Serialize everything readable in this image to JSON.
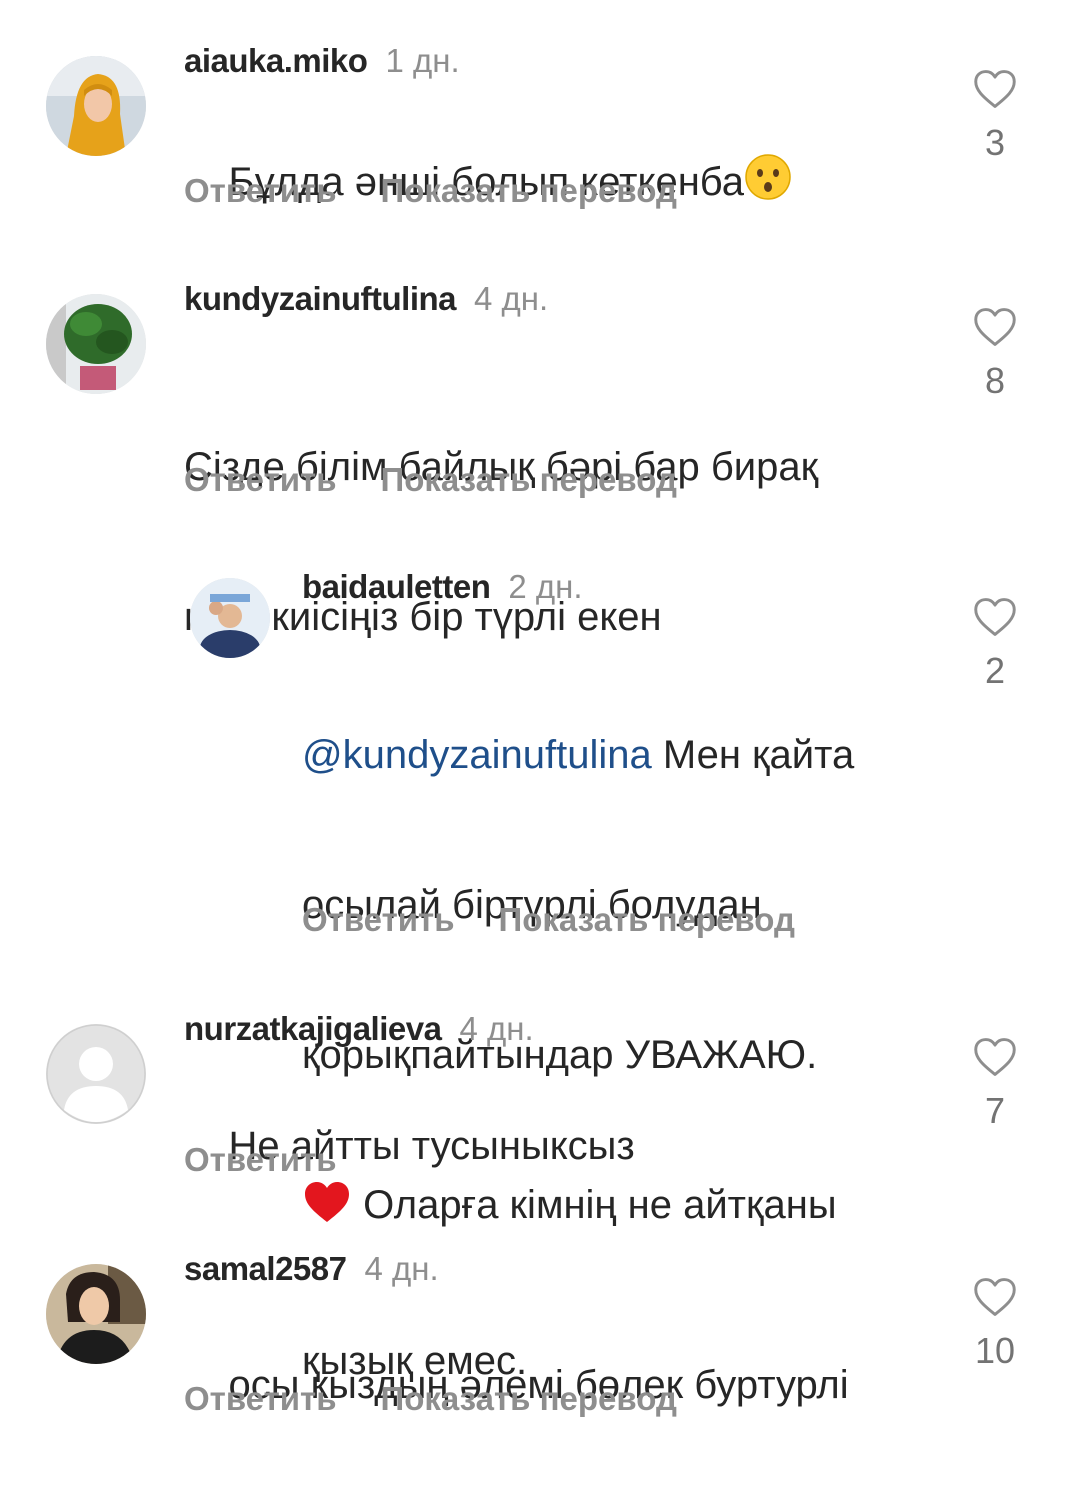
{
  "comments": [
    {
      "username": "aiauka.miko",
      "time": "1 дн.",
      "text": "Бұлда әнші болып кеткенба",
      "emoji": "hushed-face",
      "reply_label": "Ответить",
      "translate_label": "Показать перевод",
      "likes": "3"
    },
    {
      "username": "kundyzainuftulina",
      "time": "4 дн.",
      "text_line1": "Сізде білім байлық бәрі бар бирақ",
      "text_line2": "киім киісіңіз бір түрлі екен",
      "reply_label": "Ответить",
      "translate_label": "Показать перевод",
      "likes": "8"
    },
    {
      "username": "baidauletten",
      "time": "2 дн.",
      "mention": "@kundyzainuftulina",
      "text_after_mention": " Мен қайта",
      "text_line2": "осылай біртүрлі болудан",
      "text_line3": "қорықпайтындар УВАЖАЮ.",
      "emoji": "red-heart",
      "text_line4": " Оларға кімнің не айтқаны",
      "text_line5": "қызық емес.",
      "reply_label": "Ответить",
      "translate_label": "Показать перевод",
      "likes": "2"
    },
    {
      "username": "nurzatkajigalieva",
      "time": "4 дн.",
      "text": "Не айтты тусыныксыз",
      "reply_label": "Ответить",
      "likes": "7"
    },
    {
      "username": "samal2587",
      "time": "4 дн.",
      "text": "осы кыздың әлемі бөлек буртурлі",
      "reply_label": "Ответить",
      "translate_label": "Показать перевод",
      "likes": "10"
    }
  ]
}
